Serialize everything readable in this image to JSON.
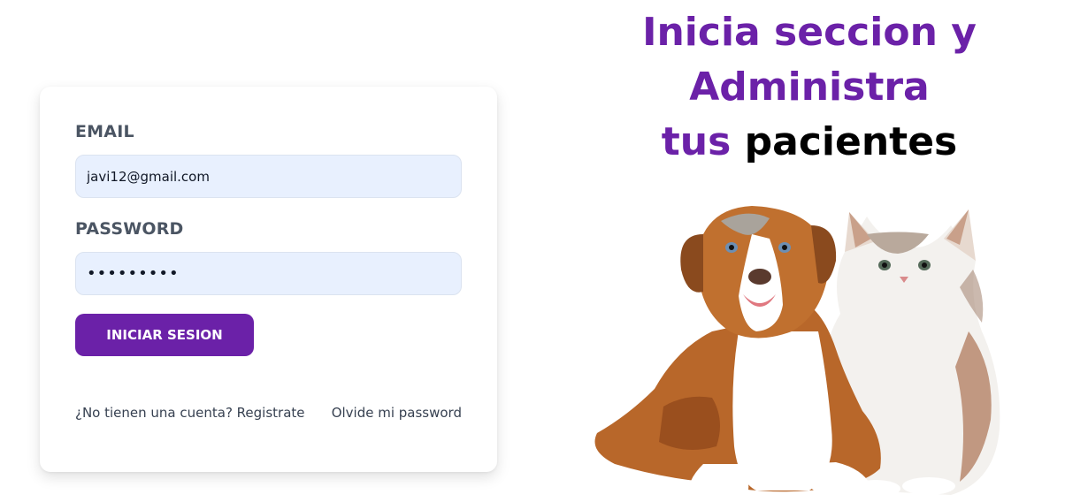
{
  "login": {
    "email_label": "EMAIL",
    "email_value": "javi12@gmail.com",
    "password_label": "PASSWORD",
    "password_value": "•••••••••",
    "submit_label": "INICIAR SESION",
    "register_link": "¿No tienen una cuenta? Registrate",
    "forgot_link": "Olvide mi password"
  },
  "hero": {
    "title_part1": "Inicia seccion y Administra",
    "title_part2": "tus",
    "title_part3": "pacientes",
    "image_icon": "dog-and-cat-illustration"
  },
  "colors": {
    "accent": "#6b21a8",
    "input_bg": "#e8f0fe",
    "label": "#4b5563"
  }
}
